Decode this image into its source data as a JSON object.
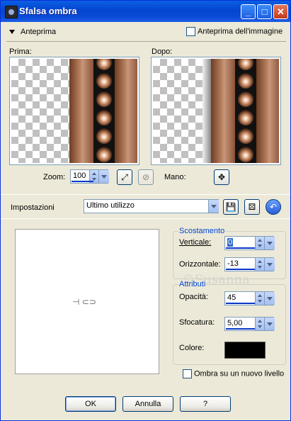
{
  "window": {
    "title": "Sfalsa ombra"
  },
  "preview_section": {
    "toggle_label": "Anteprima",
    "image_preview_checkbox_label": "Anteprima dell'immagine",
    "before_label": "Prima:",
    "after_label": "Dopo:"
  },
  "zoom": {
    "label": "Zoom:",
    "value": "100"
  },
  "pan": {
    "label": "Mano:"
  },
  "settings": {
    "label": "Impostazioni",
    "preset_value": "Ultimo utilizzo"
  },
  "offset": {
    "title": "Scostamento",
    "vertical_label": "Verticale:",
    "vertical_value": "0",
    "horizontal_label": "Orizzontale:",
    "horizontal_value": "-13"
  },
  "attributes": {
    "title": "Attributi",
    "opacity_label": "Opacità:",
    "opacity_value": "45",
    "blur_label": "Sfocatura:",
    "blur_value": "5,00",
    "color_label": "Colore:",
    "color_value": "#000000"
  },
  "new_layer_checkbox_label": "Ombra su un nuovo livello",
  "buttons": {
    "ok": "OK",
    "cancel": "Annulla",
    "help": "?"
  },
  "watermark": "©Susanna",
  "offset_widget_glyph": "⊣ ⊂⊃"
}
